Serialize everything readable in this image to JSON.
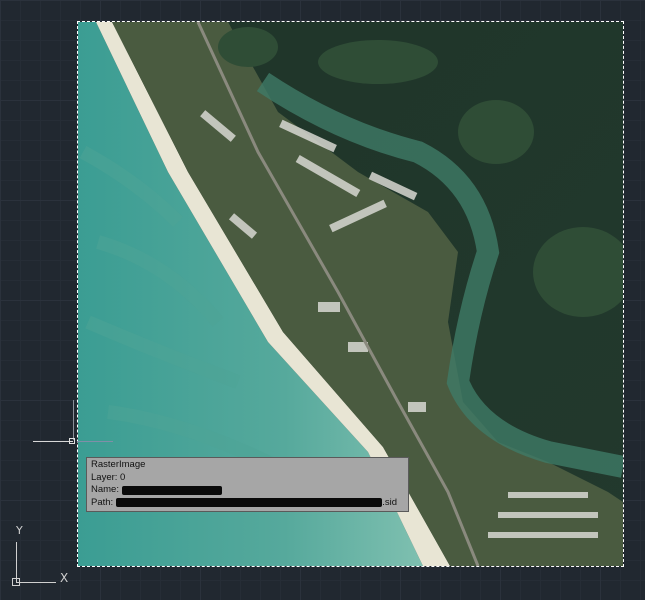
{
  "canvas": {
    "background": "#212830"
  },
  "raster_image": {
    "tooltip": {
      "type_label": "RasterImage",
      "layer_label": "Layer: 0",
      "name_prefix": "Name:",
      "path_prefix": "Path:",
      "path_suffix": ".sid"
    }
  },
  "ucs": {
    "y_label": "Y",
    "x_label": "X"
  }
}
